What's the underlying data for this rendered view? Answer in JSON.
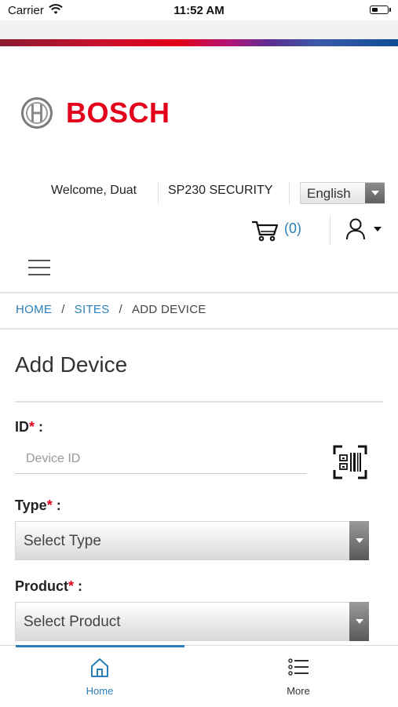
{
  "status_bar": {
    "carrier": "Carrier",
    "time": "11:52 AM"
  },
  "brand": {
    "name": "BOSCH",
    "color": "#e2001a"
  },
  "header": {
    "welcome": "Welcome, Duat",
    "company": "SP230 SECURITY",
    "language": "English",
    "cart_count": "(0)"
  },
  "breadcrumb": {
    "home": "HOME",
    "sites": "SITES",
    "current": "ADD DEVICE"
  },
  "page": {
    "title": "Add Device"
  },
  "form": {
    "id_label": "ID",
    "id_placeholder": "Device ID",
    "type_label": "Type",
    "type_value": "Select Type",
    "product_label": "Product",
    "product_value": "Select Product",
    "required_mark": "*",
    "label_suffix": " :"
  },
  "tabs": {
    "home": "Home",
    "more": "More"
  },
  "colors": {
    "accent": "#2b7fb8",
    "required": "#e2001a"
  }
}
